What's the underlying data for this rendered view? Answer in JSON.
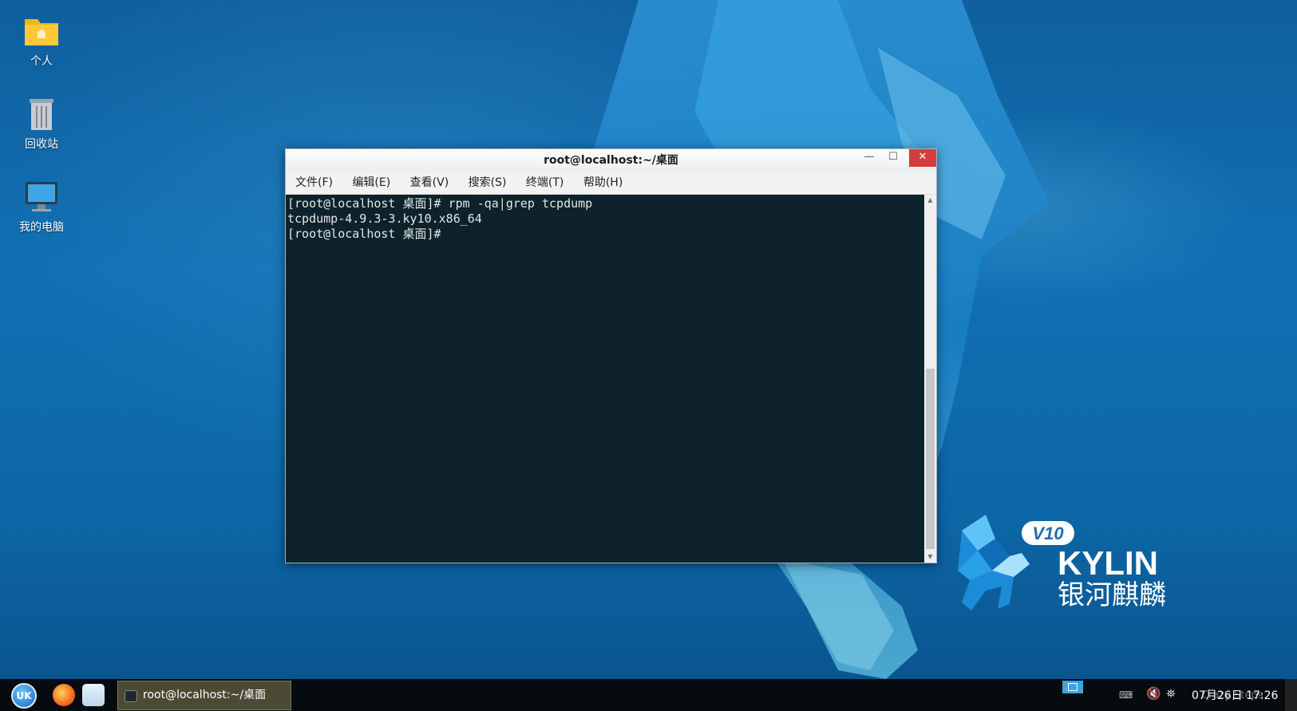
{
  "desktop": {
    "icons": [
      {
        "label": "个人"
      },
      {
        "label": "回收站"
      },
      {
        "label": "我的电脑"
      }
    ],
    "logo": {
      "version": "V10",
      "brand": "KYLIN",
      "brand_cn": "银河麒麟"
    }
  },
  "terminal": {
    "title": "root@localhost:~/桌面",
    "menu": [
      "文件(F)",
      "编辑(E)",
      "查看(V)",
      "搜索(S)",
      "终端(T)",
      "帮助(H)"
    ],
    "lines": [
      "[root@localhost 桌面]# rpm -qa|grep tcpdump",
      "tcpdump-4.9.3-3.ky10.x86_64",
      "[root@localhost 桌面]#"
    ]
  },
  "taskbar": {
    "start_label": "UK",
    "task_terminal_label": "root@localhost:~/桌面",
    "clock": "07月26日 17:26",
    "watermark": "Crazy Steps"
  },
  "colors": {
    "terminal_bg": "#0d222b",
    "close_button": "#d53c3c",
    "taskbar_bg": "#060b10"
  }
}
